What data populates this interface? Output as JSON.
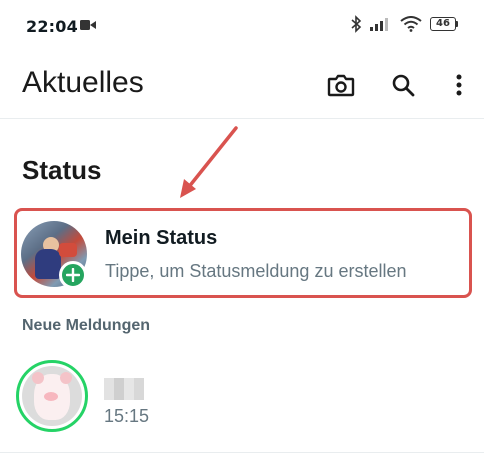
{
  "status_bar": {
    "time": "22:04",
    "battery": "46",
    "icons": [
      "video-camera-icon",
      "bluetooth-icon",
      "signal-icon",
      "wifi-icon",
      "battery-icon"
    ]
  },
  "app_bar": {
    "title": "Aktuelles",
    "actions": [
      "camera-icon",
      "search-icon",
      "more-vertical-icon"
    ]
  },
  "status_section": {
    "title": "Status",
    "my_status": {
      "name": "Mein Status",
      "hint": "Tippe, um Statusmeldung zu erstellen"
    },
    "recent_heading": "Neue Meldungen",
    "updates": [
      {
        "time": "15:15"
      }
    ]
  },
  "colors": {
    "accent_green": "#25d366",
    "badge_green": "#25a55f",
    "highlight_red": "#d9534f",
    "secondary_text": "#667781"
  }
}
